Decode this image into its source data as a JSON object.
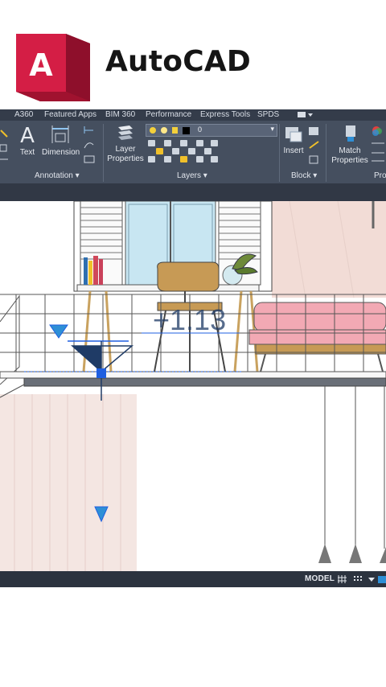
{
  "brand": {
    "title": "AutoCAD",
    "logo_letter": "A",
    "colors": {
      "logo_main": "#d41e45",
      "logo_dark": "#9b1130"
    }
  },
  "ribbon_tabs": [
    "A360",
    "Featured Apps",
    "BIM 360",
    "Performance",
    "Express Tools",
    "SPDS"
  ],
  "ribbon": {
    "buttons": {
      "text": "Text",
      "dimension": "Dimension",
      "layer_properties_line1": "Layer",
      "layer_properties_line2": "Properties",
      "insert": "Insert",
      "match_properties_line1": "Match",
      "match_properties_line2": "Properties"
    },
    "layer_dropdown_value": "0",
    "panels": {
      "annotation": "Annotation",
      "layers": "Layers",
      "block": "Block",
      "properties_partial": "Pro"
    }
  },
  "drawing": {
    "level_annotation": "+1.13",
    "colors": {
      "grip": "#1f5fe0",
      "level_marker": "#2e8fd6",
      "level_dark": "#1f3b66"
    }
  },
  "status_bar": {
    "model": "MODEL"
  }
}
